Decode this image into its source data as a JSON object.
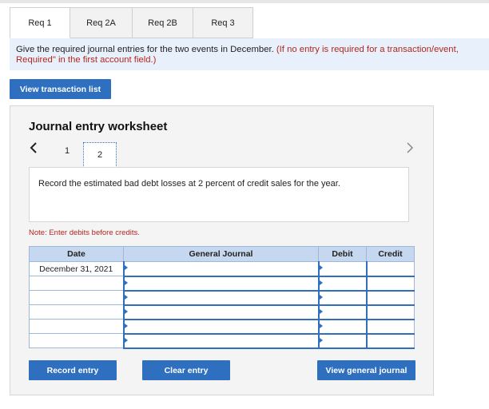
{
  "tabs": [
    "Req 1",
    "Req 2A",
    "Req 2B",
    "Req 3"
  ],
  "instruction": {
    "text": "Give the required journal entries for the two events in December.",
    "red": "(If no entry is required for a transaction/event,",
    "line2": "Required\" in the first account field.)"
  },
  "buttons": {
    "view_transaction_list": "View transaction list",
    "record_entry": "Record entry",
    "clear_entry": "Clear entry",
    "view_general_journal": "View general journal"
  },
  "worksheet": {
    "title": "Journal entry worksheet",
    "pages": [
      "1",
      "2"
    ],
    "current_page": "2",
    "description": "Record the estimated bad debt losses at 2 percent of credit sales for the year.",
    "note": "Note: Enter debits before credits."
  },
  "table": {
    "headers": [
      "Date",
      "General Journal",
      "Debit",
      "Credit"
    ],
    "rows": [
      {
        "date": "December 31, 2021"
      },
      {
        "date": ""
      },
      {
        "date": ""
      },
      {
        "date": ""
      },
      {
        "date": ""
      },
      {
        "date": ""
      }
    ]
  },
  "icons": {
    "prev": "chevron-left-icon",
    "next": "chevron-right-icon",
    "row_marker": "caret-right-icon"
  },
  "colors": {
    "accent": "#2f6fbf",
    "note_red": "#b3261e",
    "instruction_bg": "#e8f1fb",
    "table_header": "#c5d8ef"
  }
}
